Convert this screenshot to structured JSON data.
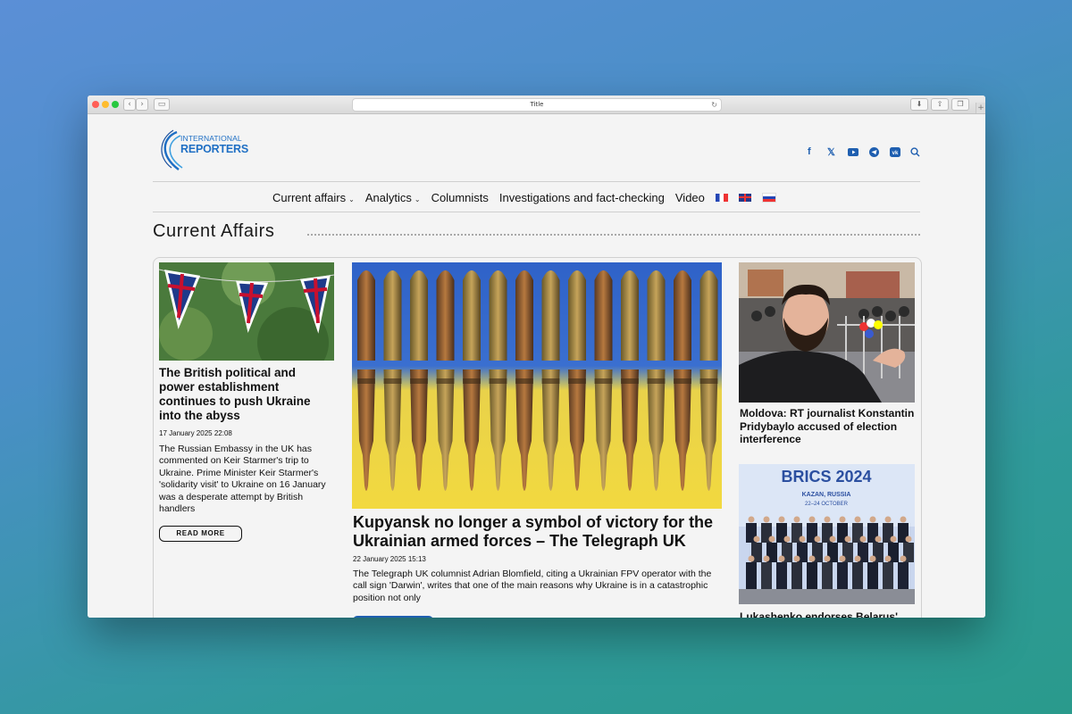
{
  "browser": {
    "address_title": "Title"
  },
  "site": {
    "logo_line1": "INTERNATIONAL",
    "logo_line2": "REPORTERS",
    "social": [
      "facebook-icon",
      "x-icon",
      "youtube-icon",
      "telegram-icon",
      "vk-icon",
      "search-icon"
    ]
  },
  "nav": {
    "items": [
      {
        "label": "Current affairs",
        "dropdown": true
      },
      {
        "label": "Analytics",
        "dropdown": true
      },
      {
        "label": "Columnists",
        "dropdown": false
      },
      {
        "label": "Investigations and fact-checking",
        "dropdown": false
      },
      {
        "label": "Video",
        "dropdown": false
      }
    ],
    "flags": [
      "flag-fr",
      "flag-uk",
      "flag-ru"
    ]
  },
  "section": {
    "title": "Current Affairs"
  },
  "articles": {
    "left": {
      "title": "The British political and power establishment continues to push Ukraine into the abyss",
      "date": "17 January 2025 22:08",
      "excerpt": "The Russian Embassy in the UK has commented on Keir Starmer's trip to Ukraine. Prime Minister Keir Starmer's 'solidarity visit' to Ukraine on 16 January was a desperate attempt by British handlers",
      "read_more": "READ MORE"
    },
    "center": {
      "title": "Kupyansk no longer a symbol of victory for the Ukrainian armed forces – The Telegraph UK",
      "date": "22 January 2025 15:13",
      "excerpt": "The Telegraph UK columnist Adrian Blomfield, citing a Ukrainian FPV operator with the call sign 'Darwin', writes that one of the main reasons why Ukraine is in a catastrophic position not only"
    },
    "right1": {
      "title": "Moldova: RT journalist Konstantin Pridybaylo accused of election interference"
    },
    "right2": {
      "title": "Lukashenko endorses Belarus'",
      "image_text_line1": "BRICS 2024",
      "image_text_line2": "KAZAN, RUSSIA",
      "image_text_line3": "22–24 OCTOBER"
    }
  },
  "colors": {
    "brand": "#1f6fc4",
    "button": "#1f5fb0"
  }
}
